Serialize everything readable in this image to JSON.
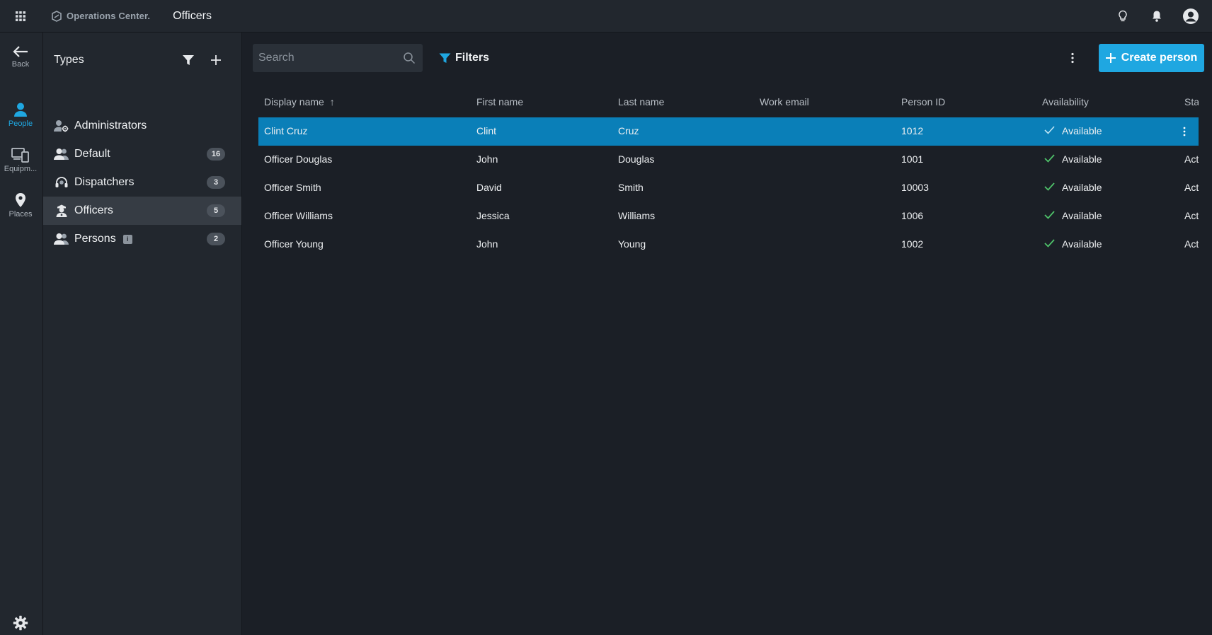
{
  "topbar": {
    "brand": "Operations Center.",
    "title": "Officers"
  },
  "rail": {
    "items": [
      {
        "label": "Back",
        "icon": "arrow-left-icon"
      },
      {
        "label": "People",
        "icon": "person-icon",
        "active": true
      },
      {
        "label": "Equipm...",
        "icon": "devices-icon"
      },
      {
        "label": "Places",
        "icon": "location-pin-icon"
      }
    ]
  },
  "types": {
    "header": "Types",
    "items": [
      {
        "label": "Administrators",
        "icon": "admin-user-icon",
        "count": ""
      },
      {
        "label": "Default",
        "icon": "group-icon",
        "count": "16"
      },
      {
        "label": "Dispatchers",
        "icon": "headset-icon",
        "count": "3"
      },
      {
        "label": "Officers",
        "icon": "officer-icon",
        "count": "5"
      },
      {
        "label": "Persons",
        "icon": "group-icon",
        "count": "2",
        "info": "i"
      }
    ]
  },
  "toolbar": {
    "search_placeholder": "Search",
    "filters_label": "Filters",
    "create_label": "Create person"
  },
  "table": {
    "sort_indicator": "↑",
    "columns": [
      "Display name",
      "First name",
      "Last name",
      "Work email",
      "Person ID",
      "Availability",
      "Sta"
    ],
    "rows": [
      {
        "display": "Clint Cruz",
        "first": "Clint",
        "last": "Cruz",
        "email": "",
        "id": "1012",
        "availability": "Available",
        "status": ""
      },
      {
        "display": "Officer Douglas",
        "first": "John",
        "last": "Douglas",
        "email": "",
        "id": "1001",
        "availability": "Available",
        "status": "Act"
      },
      {
        "display": "Officer Smith",
        "first": "David",
        "last": "Smith",
        "email": "",
        "id": "10003",
        "availability": "Available",
        "status": "Act"
      },
      {
        "display": "Officer Williams",
        "first": "Jessica",
        "last": "Williams",
        "email": "",
        "id": "1006",
        "availability": "Available",
        "status": "Act"
      },
      {
        "display": "Officer Young",
        "first": "John",
        "last": "Young",
        "email": "",
        "id": "1002",
        "availability": "Available",
        "status": "Act"
      }
    ]
  },
  "colors": {
    "accent": "#1fa7e1",
    "selected_row": "#0a7fb8",
    "available_check": "#4fc36a"
  }
}
